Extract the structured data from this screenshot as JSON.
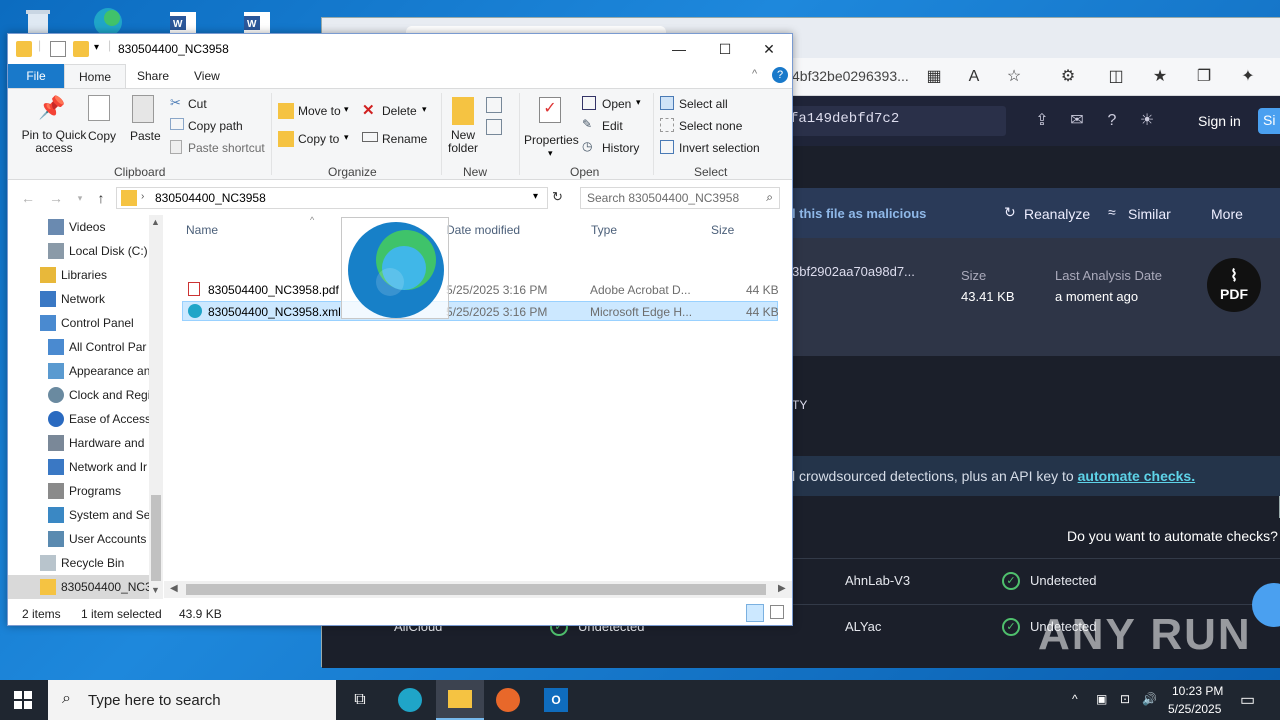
{
  "desktop": {
    "icons": [
      "recycle-bin-icon",
      "edge-desktop-icon",
      "word-doc-icon",
      "word-doc-icon"
    ]
  },
  "browser": {
    "url_fragment": "4bf32be0296393...",
    "hash_box": "fa149debfd7c2",
    "sign_in": "Sign in",
    "si_badge": "Si",
    "malicious_text": "l this file as malicious",
    "reanalyze": "Reanalyze",
    "similar": "Similar",
    "more": "More",
    "hash_partial": "3bf2902aa70a98d7...",
    "size_label": "Size",
    "size_value": "43.41 KB",
    "last_analysis_label": "Last Analysis Date",
    "last_analysis_value": "a moment ago",
    "pdf_badge": "PDF",
    "section_tail": "TY",
    "green_text": "l crowdsourced detections, plus an API key to ",
    "green_link": "automate checks.",
    "automate_question": "Do you want to automate checks?",
    "detections": [
      {
        "left_engine": "",
        "left_status": "",
        "right_engine": "AhnLab-V3",
        "right_status": "Undetected"
      },
      {
        "left_engine": "AliCloud",
        "left_status": "Undetected",
        "right_engine": "ALYac",
        "right_status": "Undetected"
      }
    ]
  },
  "explorer": {
    "title": "830504400_NC3958",
    "tabs": {
      "file": "File",
      "home": "Home",
      "share": "Share",
      "view": "View"
    },
    "clipboard": {
      "pin": "Pin to Quick access",
      "copy": "Copy",
      "paste": "Paste",
      "cut": "Cut",
      "copy_path": "Copy path",
      "paste_shortcut": "Paste shortcut",
      "group": "Clipboard"
    },
    "organize": {
      "move_to": "Move to",
      "copy_to": "Copy to",
      "delete": "Delete",
      "rename": "Rename",
      "group": "Organize"
    },
    "new": {
      "new_folder": "New folder",
      "group": "New"
    },
    "open": {
      "properties": "Properties",
      "open": "Open",
      "edit": "Edit",
      "history": "History",
      "group": "Open"
    },
    "select": {
      "select_all": "Select all",
      "select_none": "Select none",
      "invert": "Invert selection",
      "group": "Select"
    },
    "address": "830504400_NC3958",
    "search_placeholder": "Search 830504400_NC3958",
    "nav_items": [
      "Videos",
      "Local Disk (C:)",
      "Libraries",
      "Network",
      "Control Panel",
      "All Control Par",
      "Appearance an",
      "Clock and Regi",
      "Ease of Access",
      "Hardware and",
      "Network and Ir",
      "Programs",
      "System and Sec",
      "User Accounts",
      "Recycle Bin",
      "830504400_NC39"
    ],
    "columns": {
      "name": "Name",
      "date": "Date modified",
      "type": "Type",
      "size": "Size"
    },
    "files": [
      {
        "name": "830504400_NC3958.pdf",
        "date": "5/25/2025 3:16 PM",
        "type": "Adobe Acrobat D...",
        "size": "44 KB"
      },
      {
        "name": "830504400_NC3958.xml",
        "date": "5/25/2025 3:16 PM",
        "type": "Microsoft Edge H...",
        "size": "44 KB"
      }
    ],
    "status": {
      "items": "2 items",
      "selected": "1 item selected",
      "size": "43.9 KB"
    }
  },
  "taskbar": {
    "search_placeholder": "Type here to search",
    "time": "10:23 PM",
    "date": "5/25/2025"
  },
  "watermark": "ANY RUN"
}
